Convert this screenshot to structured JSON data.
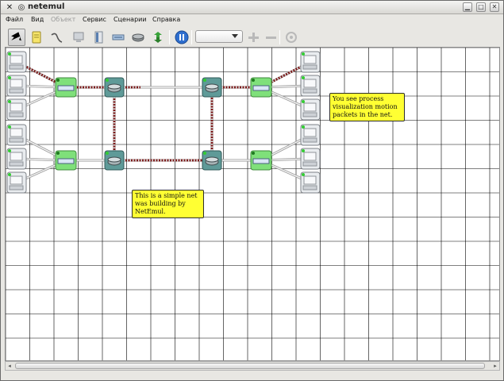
{
  "window": {
    "title": "netemul",
    "icons": [
      "window-menu-icon",
      "pin-icon",
      "minimize-icon",
      "maximize-icon",
      "close-icon"
    ]
  },
  "menu": [
    {
      "label": "Файл",
      "enabled": true
    },
    {
      "label": "Вид",
      "enabled": true
    },
    {
      "label": "Объект",
      "enabled": false
    },
    {
      "label": "Сервис",
      "enabled": true
    },
    {
      "label": "Сценарии",
      "enabled": true
    },
    {
      "label": "Справка",
      "enabled": true
    }
  ],
  "toolbar": {
    "tools": [
      "pointer-tool-icon",
      "note-tool-icon",
      "cable-tool-icon",
      "computer-tool-icon",
      "server-tool-icon",
      "hub-tool-icon",
      "router-tool-icon",
      "switch-tool-icon",
      "pause-icon"
    ],
    "zoom_select_value": "",
    "zoom_in_icon": "plus-icon",
    "zoom_out_icon": "minus-icon",
    "reset_icon": "reset-icon"
  },
  "notes": [
    {
      "text": "You see process visualization motion packets in the net.",
      "lines": [
        "You see process",
        "visualization motion",
        "packets in the net."
      ]
    },
    {
      "text": "This is a simple net was building by NetEmul.",
      "lines": [
        "This is a simple net",
        "was building by",
        "NetEmul."
      ]
    }
  ],
  "devices": {
    "left_computers": 6,
    "right_computers": 6,
    "hubs": 4,
    "routers": 4
  },
  "colors": {
    "hub_green": "#7fe07a",
    "router_teal": "#5f9a98",
    "cable_active": "#7a1a1a",
    "cable_idle": "#c8c8c8",
    "note_yellow": "#ffff33",
    "grid_line": "#000000"
  }
}
